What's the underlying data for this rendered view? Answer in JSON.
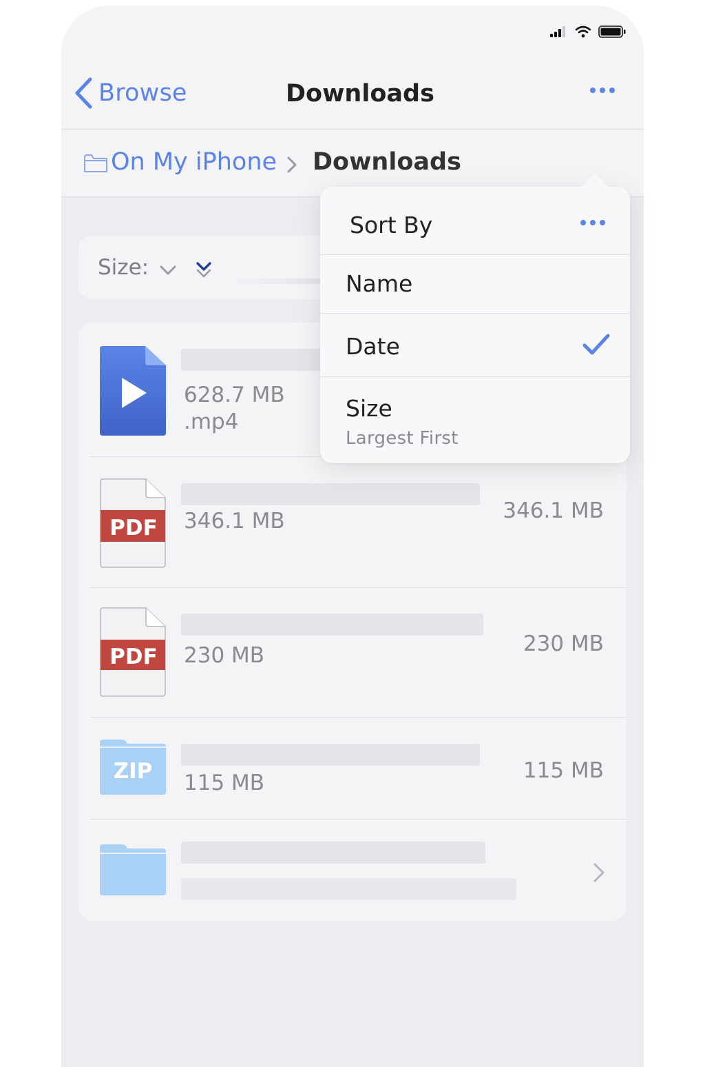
{
  "nav": {
    "back_label": "Browse",
    "title": "Downloads",
    "more_icon": "ellipsis-icon"
  },
  "breadcrumb": {
    "root_label": "On My iPhone",
    "current_label": "Downloads"
  },
  "sort_bar": {
    "label": "Size:"
  },
  "files": [
    {
      "type": "video",
      "meta": "628.7 MB",
      "ext": ".mp4"
    },
    {
      "type": "pdf",
      "badge": "PDF",
      "meta": "346.1 MB",
      "size": "346.1 MB"
    },
    {
      "type": "pdf",
      "badge": "PDF",
      "meta": "230 MB",
      "size": "230 MB"
    },
    {
      "type": "zip",
      "badge": "ZIP",
      "meta": "115 MB",
      "size": "115 MB"
    },
    {
      "type": "folder"
    }
  ],
  "sort_menu": {
    "title": "Sort By",
    "items": [
      {
        "label": "Name",
        "selected": false
      },
      {
        "label": "Date",
        "selected": true
      },
      {
        "label": "Size",
        "subtitle": "Largest First",
        "selected": false
      }
    ]
  },
  "colors": {
    "accent": "#5a84e8",
    "pdf_red": "#c0463f",
    "zip_blue": "#a9d0f5",
    "video_blue": "#4b72d6"
  }
}
